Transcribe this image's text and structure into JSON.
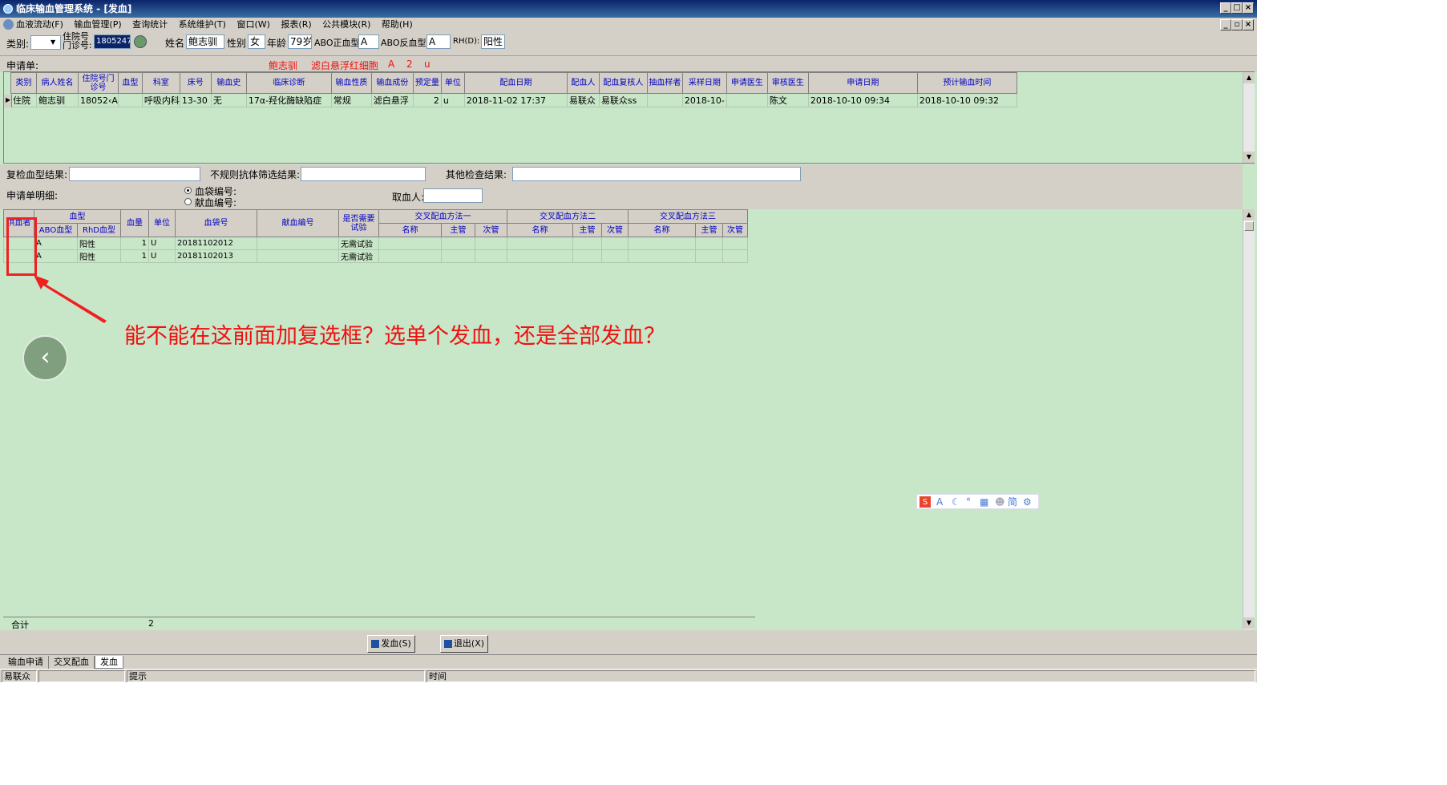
{
  "window": {
    "title": "临床输血管理系统 - [发血]"
  },
  "menu": [
    "血液流动(F)",
    "输血管理(P)",
    "查询统计",
    "系统维护(T)",
    "窗口(W)",
    "报表(R)",
    "公共模块(R)",
    "帮助(H)"
  ],
  "patient": {
    "category_label": "类别:",
    "category_value": "",
    "hospital_no_label_1": "住院号",
    "hospital_no_label_2": "门诊号:",
    "hospital_no_value": "1805247",
    "name_label": "姓名",
    "name_value": "鲍志驯",
    "sex_label": "性别",
    "sex_value": "女",
    "age_label": "年龄",
    "age_value": "79岁",
    "abo_forward_label": "ABO正血型",
    "abo_forward_value": "A",
    "abo_reverse_label": "ABO反血型:",
    "abo_reverse_value": "A",
    "rh_label": "RH(D):",
    "rh_value": "阳性"
  },
  "request_strip": {
    "label": "申请单:",
    "patient": "鲍志驯",
    "product": "滤白悬浮红细胞",
    "abo": "A",
    "amount": "2",
    "unit": "u"
  },
  "request_table": {
    "headers": [
      "类别",
      "病人姓名",
      "住院号门诊号",
      "血型",
      "科室",
      "床号",
      "输血史",
      "临床诊断",
      "输血性质",
      "输血成份",
      "预定量",
      "单位",
      "配血日期",
      "配血人",
      "配血复核人",
      "抽血样者",
      "采样日期",
      "申请医生",
      "审核医生",
      "申请日期",
      "预计输血时间"
    ],
    "rows": [
      [
        "住院",
        "鲍志驯",
        "18052‹A",
        "",
        "呼吸内科",
        "13-30",
        "无",
        "17α-羟化酶缺陷症",
        "常规",
        "滤白悬浮",
        "2",
        "u",
        "2018-11-02 17:37",
        "易联众",
        "易联众ss",
        "",
        "2018-10-",
        "",
        "陈文",
        "2018-10-10 09:34",
        "2018-10-10 09:32"
      ]
    ]
  },
  "recheck": {
    "retype_label": "复检血型结果:",
    "antibody_label": "不规则抗体筛选结果:",
    "other_label": "其他检查结果:"
  },
  "detail": {
    "label": "申请单明细:",
    "radio_bag": "血袋编号:",
    "radio_donor": "献血编号:",
    "taker_label": "取血人:",
    "headers": {
      "supplier": "供血者",
      "blood_type": "血型",
      "abo": "ABO血型",
      "rhd": "RhD血型",
      "volume": "血量",
      "unit": "单位",
      "bag_no": "血袋号",
      "donor_no": "献血编号",
      "test_needed": "是否需要试验",
      "method1": "交叉配血方法一",
      "method2": "交叉配血方法二",
      "method3": "交叉配血方法三",
      "name": "名称",
      "main": "主管",
      "minor": "次管"
    },
    "rows": [
      {
        "abo": "A",
        "rhd": "阳性",
        "volume": "1",
        "unit": "U",
        "bag_no": "20181102012",
        "test": "无需试验"
      },
      {
        "abo": "A",
        "rhd": "阳性",
        "volume": "1",
        "unit": "U",
        "bag_no": "20181102013",
        "test": "无需试验"
      }
    ],
    "total_label": "合计",
    "total_value": "2"
  },
  "buttons": {
    "issue": "发血(S)",
    "exit": "退出(X)"
  },
  "tabs": [
    "输血申请",
    "交叉配血",
    "发血"
  ],
  "status": {
    "user": "易联众ss",
    "tip": "提示",
    "time": "时间"
  },
  "annotation": {
    "text": "能不能在这前面加复选框？选单个发血，还是全部发血？"
  },
  "ime": {
    "simplified": "简"
  },
  "colors": {
    "annotation": "#f01010",
    "grid_bg": "#c8e6c8",
    "header_text": "#0000c0"
  }
}
